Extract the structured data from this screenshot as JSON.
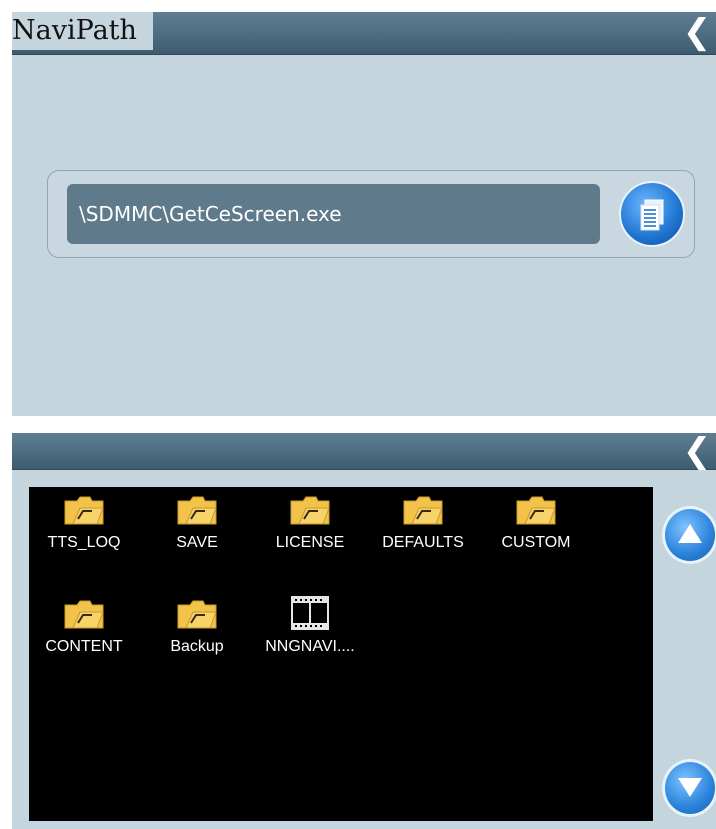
{
  "screen1": {
    "title": "NaviPath",
    "path_value": "\\SDMMC\\GetCeScreen.exe"
  },
  "screen2": {
    "files": [
      {
        "name": "TTS_LOQ",
        "type": "folder"
      },
      {
        "name": "SAVE",
        "type": "folder"
      },
      {
        "name": "LICENSE",
        "type": "folder"
      },
      {
        "name": "DEFAULTS",
        "type": "folder"
      },
      {
        "name": "CUSTOM",
        "type": "folder"
      },
      {
        "name": "CONTENT",
        "type": "folder"
      },
      {
        "name": "Backup",
        "type": "folder"
      },
      {
        "name": "NNGNAVI....",
        "type": "file"
      }
    ]
  },
  "icons": {
    "back": "chevron-left-icon",
    "browse": "document-icon",
    "folder": "folder-icon",
    "file": "film-file-icon",
    "scroll_up": "arrow-up-icon",
    "scroll_down": "arrow-down-icon"
  },
  "colors": {
    "titlebar": "#4d6c80",
    "background": "#c5d5dd",
    "path_field": "#5e7a8b",
    "accent_blue": "#1e74d1",
    "folder": "#f2c24a"
  }
}
